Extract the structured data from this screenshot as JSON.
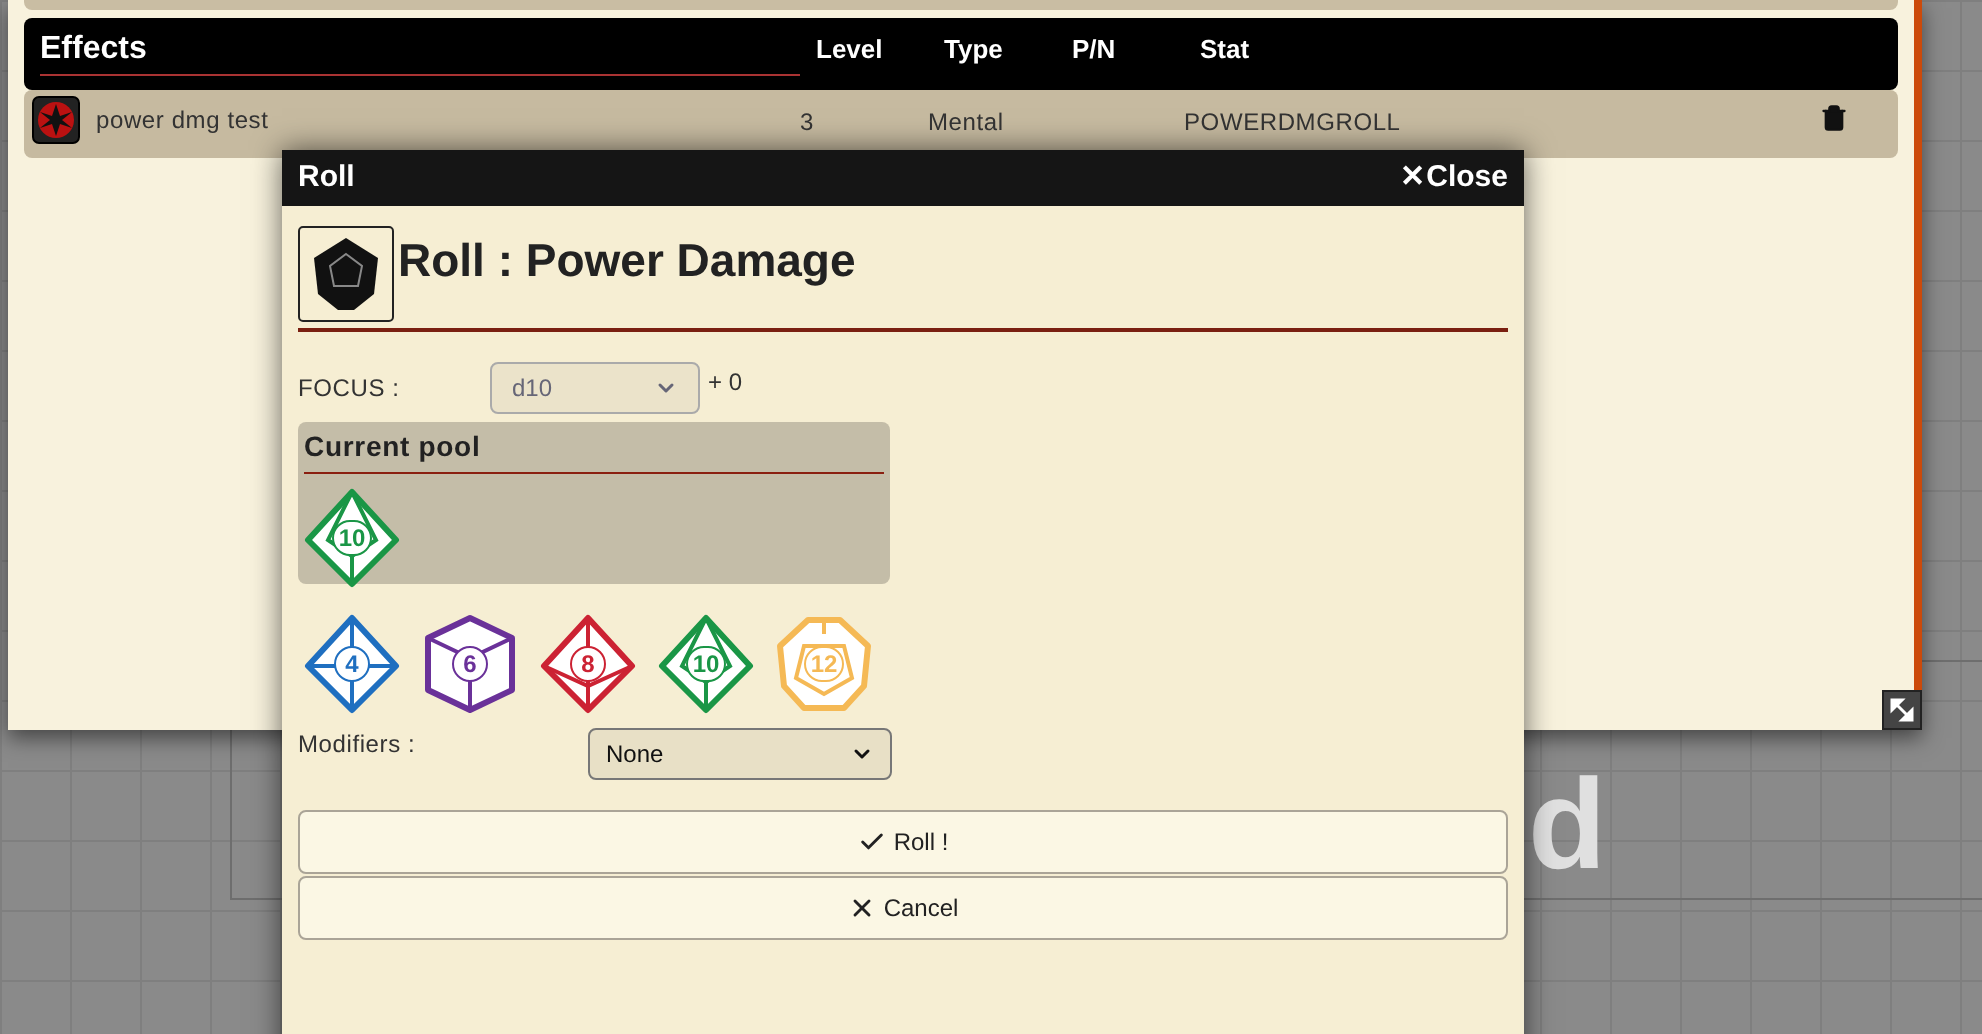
{
  "effects": {
    "columns": [
      "Effects",
      "Level",
      "Type",
      "P/N",
      "Stat"
    ],
    "rows": [
      {
        "name": "power dmg test",
        "level": "3",
        "type": "Mental",
        "stat": "POWERDMGROLL"
      }
    ]
  },
  "background_text": "d",
  "dialog": {
    "title": "Roll",
    "close": "✕Close",
    "heading": "Roll : Power Damage",
    "focus": {
      "label": "FOCUS :",
      "value": "d10",
      "bonus": "+ 0"
    },
    "pool": {
      "title": "Current pool",
      "dice": [
        {
          "kind": "d10",
          "label": "10",
          "color": "#1a9646"
        }
      ]
    },
    "dice": [
      {
        "kind": "d4",
        "label": "4",
        "color": "#1f6fc0"
      },
      {
        "kind": "d6",
        "label": "6",
        "color": "#6a3199"
      },
      {
        "kind": "d8",
        "label": "8",
        "color": "#cc2233"
      },
      {
        "kind": "d10",
        "label": "10",
        "color": "#1a9646"
      },
      {
        "kind": "d12",
        "label": "12",
        "color": "#f5b955"
      }
    ],
    "modifiers": {
      "label": "Modifiers :",
      "value": "None"
    },
    "buttons": [
      {
        "kind": "confirm",
        "label": "Roll !"
      },
      {
        "kind": "cancel",
        "label": "Cancel"
      }
    ]
  }
}
